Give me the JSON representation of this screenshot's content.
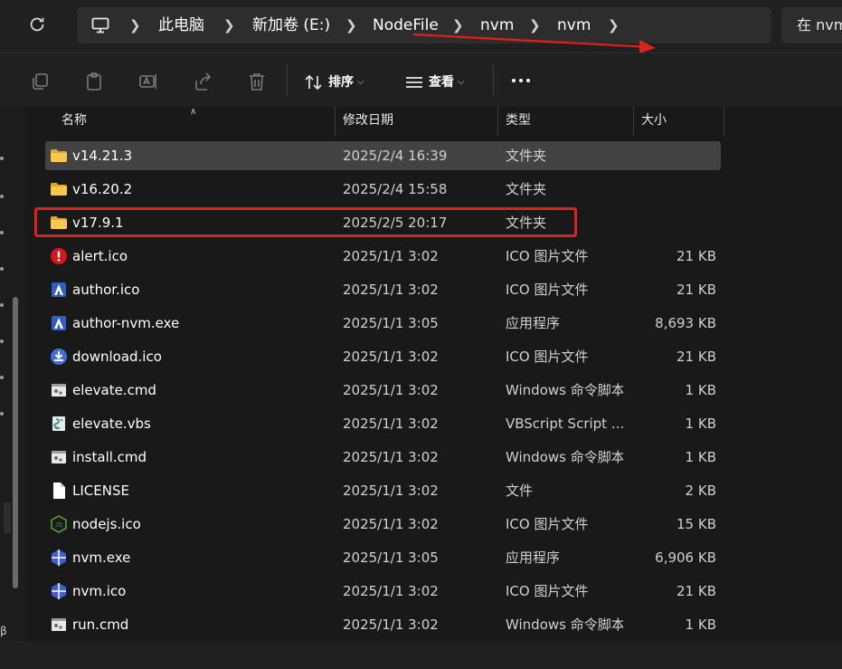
{
  "address": {
    "breadcrumbs": [
      "此电脑",
      "新加卷 (E:)",
      "NodeFile",
      "nvm",
      "nvm"
    ],
    "search_placeholder": "在 nvm 中搜索"
  },
  "toolbar": {
    "sort_label": "排序",
    "view_label": "查看"
  },
  "columns": {
    "name": "名称",
    "modified": "修改日期",
    "type": "类型",
    "size": "大小"
  },
  "files": [
    {
      "name": "v14.21.3",
      "modified": "2025/2/4 16:39",
      "type": "文件夹",
      "size": "",
      "icon": "folder-icon",
      "selected": true
    },
    {
      "name": "v16.20.2",
      "modified": "2025/2/4 15:58",
      "type": "文件夹",
      "size": "",
      "icon": "folder-icon"
    },
    {
      "name": "v17.9.1",
      "modified": "2025/2/5 20:17",
      "type": "文件夹",
      "size": "",
      "icon": "folder-icon",
      "highlighted": true
    },
    {
      "name": "alert.ico",
      "modified": "2025/1/1 3:02",
      "type": "ICO 图片文件",
      "size": "21 KB",
      "icon": "alert-icon"
    },
    {
      "name": "author.ico",
      "modified": "2025/1/1 3:02",
      "type": "ICO 图片文件",
      "size": "21 KB",
      "icon": "author-icon"
    },
    {
      "name": "author-nvm.exe",
      "modified": "2025/1/1 3:05",
      "type": "应用程序",
      "size": "8,693 KB",
      "icon": "author-icon"
    },
    {
      "name": "download.ico",
      "modified": "2025/1/1 3:02",
      "type": "ICO 图片文件",
      "size": "21 KB",
      "icon": "download-icon"
    },
    {
      "name": "elevate.cmd",
      "modified": "2025/1/1 3:02",
      "type": "Windows 命令脚本",
      "size": "1 KB",
      "icon": "cmd-file-icon"
    },
    {
      "name": "elevate.vbs",
      "modified": "2025/1/1 3:02",
      "type": "VBScript Script ...",
      "size": "1 KB",
      "icon": "vbs-file-icon"
    },
    {
      "name": "install.cmd",
      "modified": "2025/1/1 3:02",
      "type": "Windows 命令脚本",
      "size": "1 KB",
      "icon": "cmd-file-icon"
    },
    {
      "name": "LICENSE",
      "modified": "2025/1/1 3:02",
      "type": "文件",
      "size": "2 KB",
      "icon": "blank-file-icon"
    },
    {
      "name": "nodejs.ico",
      "modified": "2025/1/1 3:02",
      "type": "ICO 图片文件",
      "size": "15 KB",
      "icon": "nodejs-icon"
    },
    {
      "name": "nvm.exe",
      "modified": "2025/1/1 3:05",
      "type": "应用程序",
      "size": "6,906 KB",
      "icon": "nvm-icon"
    },
    {
      "name": "nvm.ico",
      "modified": "2025/1/1 3:02",
      "type": "ICO 图片文件",
      "size": "21 KB",
      "icon": "nvm-icon"
    },
    {
      "name": "run.cmd",
      "modified": "2025/1/1 3:02",
      "type": "Windows 命令脚本",
      "size": "1 KB",
      "icon": "cmd-file-icon"
    }
  ],
  "colors": {
    "annotation": "#e0201c",
    "folder": "#f0c44a",
    "alert": "#d4161d",
    "blue": "#3f6fd8"
  }
}
